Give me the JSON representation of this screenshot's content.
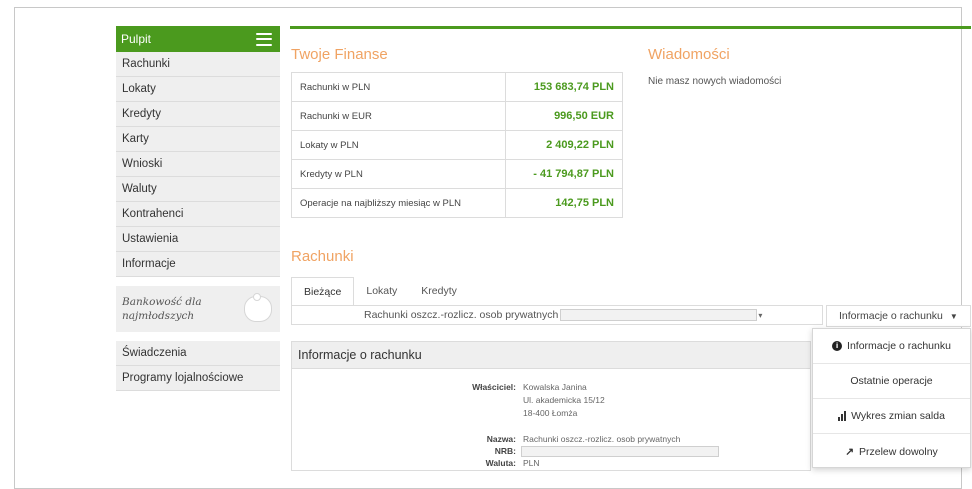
{
  "sidebar": {
    "header": "Pulpit",
    "items": [
      "Rachunki",
      "Lokaty",
      "Kredyty",
      "Karty",
      "Wnioski",
      "Waluty",
      "Kontrahenci",
      "Ustawienia",
      "Informacje"
    ],
    "kids_line1": "Bankowość dla",
    "kids_line2": "najmłodszych",
    "extra_items": [
      "Świadczenia",
      "Programy lojalnościowe"
    ]
  },
  "finances": {
    "title": "Twoje Finanse",
    "rows": [
      {
        "label": "Rachunki w PLN",
        "value": "153 683,74 PLN"
      },
      {
        "label": "Rachunki w EUR",
        "value": "996,50 EUR"
      },
      {
        "label": "Lokaty w PLN",
        "value": "2 409,22 PLN"
      },
      {
        "label": "Kredyty w PLN",
        "value": "- 41 794,87 PLN"
      },
      {
        "label": "Operacje na najbliższy miesiąc w PLN",
        "value": "142,75 PLN"
      }
    ]
  },
  "messages": {
    "title": "Wiadomości",
    "text": "Nie masz nowych wiadomości"
  },
  "accounts": {
    "title": "Rachunki",
    "tabs": [
      "Bieżące",
      "Lokaty",
      "Kredyty"
    ],
    "selected_account": "Rachunki oszcz.-rozlicz. osob prywatnych",
    "info_button": "Informacje o rachunku",
    "menu": [
      "Informacje o rachunku",
      "Ostatnie operacje",
      "Wykres zmian salda",
      "Przelew dowolny"
    ]
  },
  "account_info": {
    "title": "Informacje o rachunku",
    "owner_label": "Właściciel:",
    "owner_lines": [
      "Kowalska Janina",
      "Ul. akademicka 15/12",
      "18-400 Łomża"
    ],
    "name_label": "Nazwa:",
    "name_value": "Rachunki oszcz.-rozlicz. osob prywatnych",
    "nrb_label": "NRB:",
    "currency_label": "Waluta:",
    "currency_value": "PLN"
  },
  "colors": {
    "accent": "#4b9a1e",
    "section_title": "#f0a363"
  }
}
